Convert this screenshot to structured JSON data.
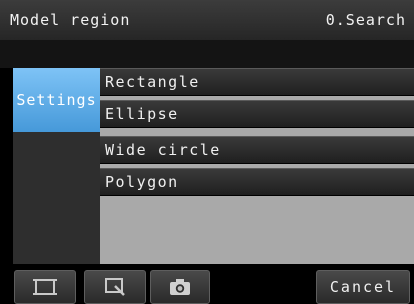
{
  "header": {
    "title": "Model region",
    "right_label": "0.Search"
  },
  "sidebar": {
    "tab_label": "Settings"
  },
  "menu": {
    "items": [
      {
        "label": "Rectangle"
      },
      {
        "label": "Ellipse"
      },
      {
        "label": "Wide circle"
      },
      {
        "label": "Polygon"
      }
    ]
  },
  "footer": {
    "buttons": [
      {
        "icon": "full-screen-icon"
      },
      {
        "icon": "zoom-region-icon"
      },
      {
        "icon": "camera-icon"
      }
    ],
    "cancel_label": "Cancel"
  }
}
